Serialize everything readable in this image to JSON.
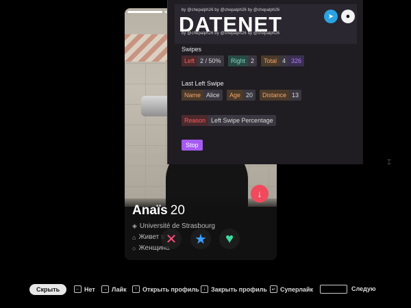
{
  "card": {
    "name": "Anaïs",
    "age": "20",
    "school": "Université de Strasbourg",
    "lives_in": "Живет в",
    "gender": "Женщина"
  },
  "panel": {
    "credits": [
      "by @chepalph26 by @chepalph26 by @chepalph26",
      "by @chepalph26 by @chepalph26 by @chepalph26"
    ],
    "logo": "DATENET",
    "swipes_title": "Swipes",
    "swipes": {
      "left_label": "Left",
      "left_value": "2 / 50%",
      "right_label": "Right",
      "right_value": "2",
      "total_label": "Total",
      "total_value": "4",
      "total_extra": "326"
    },
    "last_left_title": "Last Left Swipe",
    "last_left": {
      "name_label": "Name",
      "name_value": "Alice",
      "age_label": "Age",
      "age_value": "20",
      "distance_label": "Distance",
      "distance_value": "13"
    },
    "reason_label": "Reason",
    "reason_value": "Left Swipe Percentage",
    "stop_label": "Stop"
  },
  "hints": {
    "hide": "Скрыть",
    "no": "Нет",
    "like": "Лайк",
    "open_profile": "Открыть профиль",
    "close_profile": "Закрыть профиль",
    "superlike": "Суперлайк",
    "next": "Следую"
  },
  "colors": {
    "accent_purple": "#a65bf0",
    "nope": "#ff4f7b",
    "superlike": "#3aa0ff",
    "like": "#3cdca0",
    "telegram": "#2aa3e2"
  },
  "icons": {
    "nope": "close-icon",
    "superlike": "star-icon",
    "like": "heart-icon",
    "down": "arrow-down-icon"
  }
}
